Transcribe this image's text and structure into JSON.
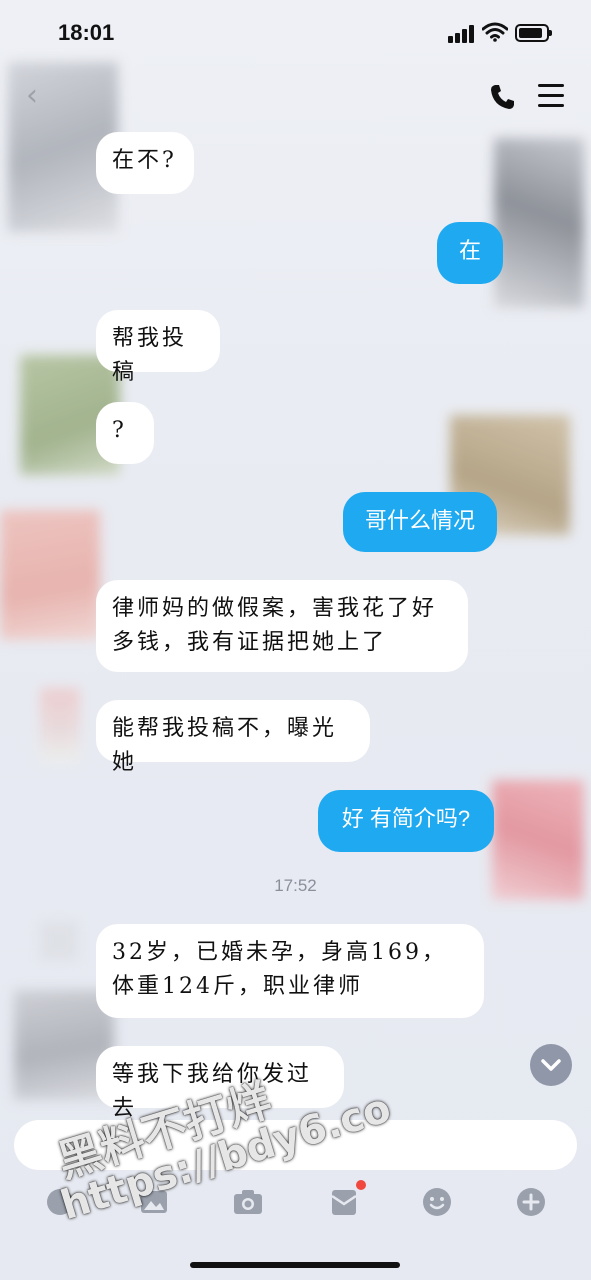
{
  "status_bar": {
    "time": "18:01"
  },
  "chat": {
    "timestamp": "17:52",
    "messages": [
      {
        "side": "in",
        "text": "在不?"
      },
      {
        "side": "out",
        "text": "在"
      },
      {
        "side": "in",
        "text": "帮我投稿"
      },
      {
        "side": "in",
        "text": "?"
      },
      {
        "side": "out",
        "text": "哥什么情况"
      },
      {
        "side": "in",
        "text": "律师妈的做假案，害我花了好多钱，我有证据把她上了"
      },
      {
        "side": "in",
        "text": "能帮我投稿不，曝光她"
      },
      {
        "side": "out",
        "text": "好 有简介吗?"
      },
      {
        "side": "in",
        "text": "32岁，已婚未孕，身高169，体重124斤，职业律师"
      },
      {
        "side": "in",
        "text": "等我下我给你发过去"
      }
    ]
  },
  "toolbar": {
    "items": [
      "mic-icon",
      "image-icon",
      "camera-icon",
      "red-packet-icon",
      "emoji-icon",
      "plus-icon"
    ],
    "badge_color": "#f0483e"
  },
  "watermark": {
    "line1": "黑料不打烊",
    "line2": "https://bdy6.co"
  },
  "colors": {
    "outgoing_bubble": "#1ea9f0",
    "incoming_bubble": "#ffffff",
    "background": "#eceef4"
  }
}
